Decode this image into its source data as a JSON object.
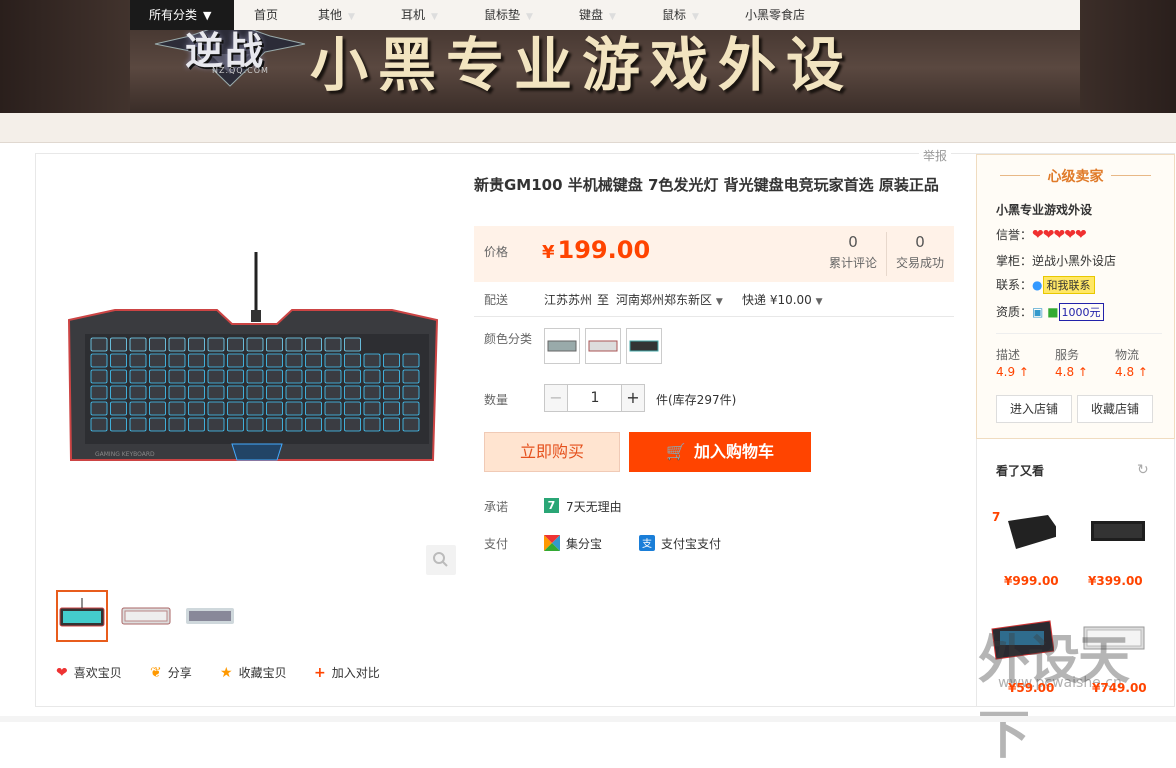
{
  "header": {
    "logo_text": "逆战",
    "logo_sub": "NZ.QQ.COM",
    "shop_title": "小黑专业游戏外设"
  },
  "nav": {
    "all": "所有分类",
    "items": [
      "首页",
      "其他",
      "耳机",
      "鼠标垫",
      "键盘",
      "鼠标",
      "小黑零食店"
    ]
  },
  "report": "举报",
  "product": {
    "title": "新贵GM100 半机械键盘 7色发光灯 背光键盘电竞玩家首选 原装正品",
    "price_label": "价格",
    "currency": "¥",
    "price": "199.00",
    "reviews_count": "0",
    "reviews_label": "累计评论",
    "sales_count": "0",
    "sales_label": "交易成功",
    "ship_label": "配送",
    "ship_from": "江苏苏州",
    "ship_to_word": "至",
    "ship_to": "河南郑州郑东新区",
    "ship_fee": "快递 ¥10.00",
    "color_label": "颜色分类",
    "qty_label": "数量",
    "qty_value": "1",
    "qty_minus": "−",
    "qty_plus": "+",
    "stock": "件(库存297件)",
    "buy_now": "立即购买",
    "add_cart": "加入购物车",
    "promise_label": "承诺",
    "promise_badge": "7",
    "promise": "7天无理由",
    "pay_label": "支付",
    "pay1": "集分宝",
    "pay2": "支付宝支付"
  },
  "actions": {
    "like": "喜欢宝贝",
    "share": "分享",
    "fav": "收藏宝贝",
    "compare": "加入对比"
  },
  "seller": {
    "level": "心级卖家",
    "name": "小黑专业游戏外设",
    "credit_label": "信誉：",
    "hearts": "❤❤❤❤❤",
    "keeper_label": "掌柜：",
    "keeper": "逆战小黑外设店",
    "contact_label": "联系：",
    "contact": "和我联系",
    "qual_label": "资质：",
    "deposit": "1000元",
    "desc_label": "描述",
    "desc_score": "4.9",
    "service_label": "服务",
    "service_score": "4.8",
    "logistics_label": "物流",
    "logistics_score": "4.8",
    "enter_shop": "进入店铺",
    "fav_shop": "收藏店铺"
  },
  "also_viewed": {
    "title": "看了又看",
    "prices": [
      "¥999.00",
      "¥399.00",
      "¥59.00",
      "¥749.00"
    ]
  },
  "watermark": {
    "text": "外设天下",
    "url": "www.pcwaishe.cn"
  },
  "colors": {
    "accent": "#ff4400",
    "price": "#f40",
    "nav_dark": "#1a1a1a"
  }
}
